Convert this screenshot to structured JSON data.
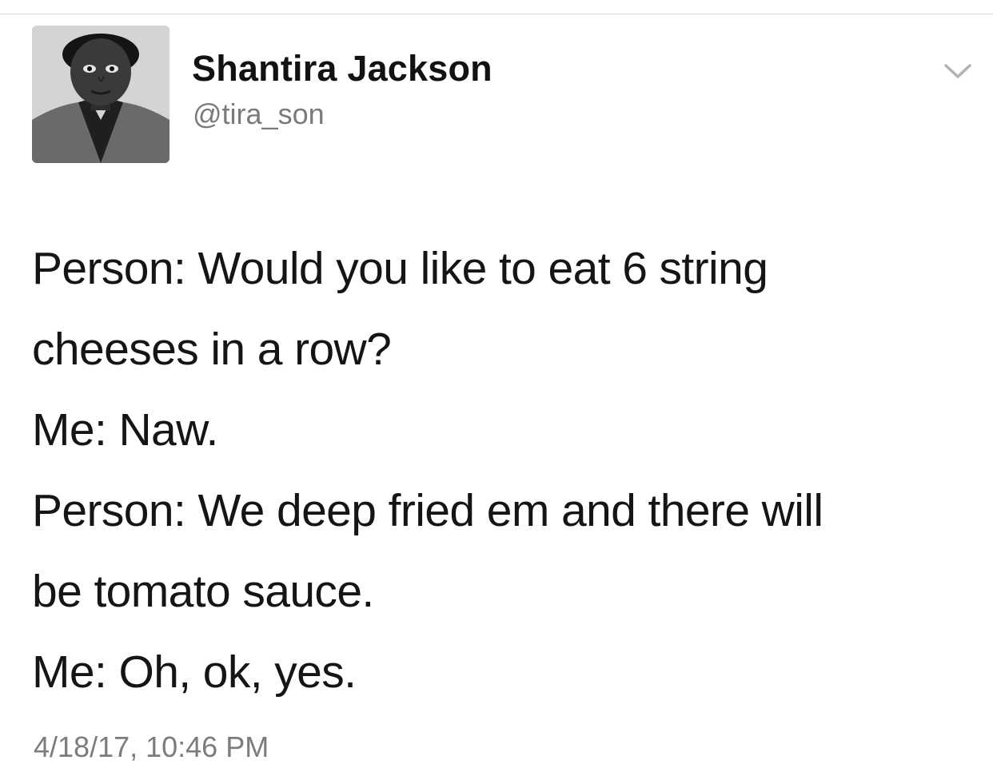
{
  "tweet": {
    "author": {
      "display_name": "Shantira Jackson",
      "handle": "@tira_son",
      "avatar_icon": "profile-photo"
    },
    "menu_icon": "chevron-down-icon",
    "lines": [
      "Person: Would you like to eat 6 string",
      "cheeses in a row?",
      "Me: Naw.",
      "Person: We deep fried em and there will",
      "be tomato sauce.",
      "Me: Oh, ok, yes."
    ],
    "timestamp": "4/18/17, 10:46 PM"
  },
  "colors": {
    "text_primary": "#141414",
    "text_secondary": "#7a7a7a",
    "chevron": "#b3b3b3",
    "divider": "#d8d8d8",
    "background": "#ffffff"
  }
}
